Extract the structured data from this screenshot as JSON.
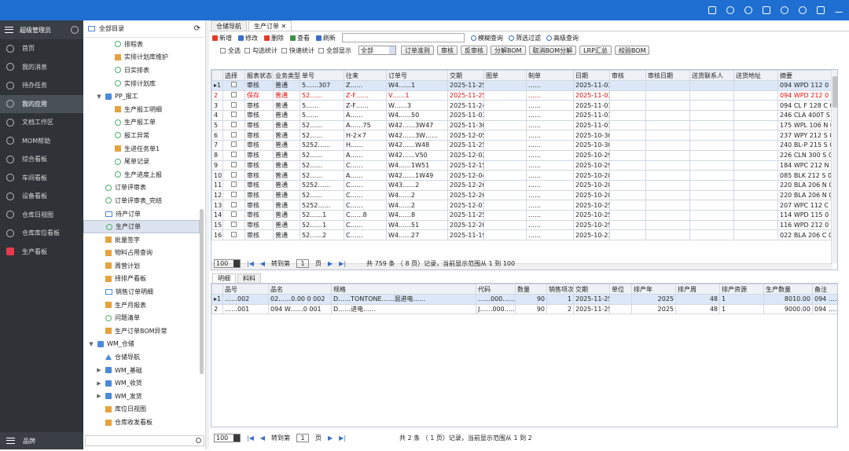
{
  "user": "超级管理员",
  "nav": [
    {
      "label": "首页",
      "active": false
    },
    {
      "label": "我的消息",
      "active": false
    },
    {
      "label": "待办任务",
      "active": false
    },
    {
      "label": "我的应用",
      "active": true
    },
    {
      "label": "文档工作区",
      "active": false
    },
    {
      "label": "MOM帮助",
      "active": false
    },
    {
      "label": "综合看板",
      "active": false
    },
    {
      "label": "车间看板",
      "active": false
    },
    {
      "label": "设备看板",
      "active": false
    },
    {
      "label": "仓库日视图",
      "active": false
    },
    {
      "label": "仓库库位看板",
      "active": false
    },
    {
      "label": "生产看板",
      "active": false
    }
  ],
  "nav_footer": "品牌",
  "tree": {
    "title": "全部目录",
    "search_placeholder": "",
    "nodes": [
      {
        "label": "排程表",
        "icon": "g",
        "indent": 1,
        "arrow": ""
      },
      {
        "label": "实排计划库维护",
        "icon": "sq",
        "indent": 1,
        "arrow": ""
      },
      {
        "label": "日实排表",
        "icon": "g",
        "indent": 1,
        "arrow": ""
      },
      {
        "label": "实排计划库",
        "icon": "g",
        "indent": 1,
        "arrow": ""
      },
      {
        "label": "PP_报工",
        "icon": "b",
        "indent": 0,
        "arrow": "▼"
      },
      {
        "label": "生产报工明细",
        "icon": "sq",
        "indent": 1,
        "arrow": ""
      },
      {
        "label": "生产报工单",
        "icon": "g",
        "indent": 1,
        "arrow": ""
      },
      {
        "label": "报工异常",
        "icon": "g",
        "indent": 1,
        "arrow": ""
      },
      {
        "label": "生进任务单1",
        "icon": "sq",
        "indent": 1,
        "arrow": ""
      },
      {
        "label": "尾单记录",
        "icon": "g",
        "indent": 1,
        "arrow": ""
      },
      {
        "label": "生产进度上报",
        "icon": "g",
        "indent": 1,
        "arrow": ""
      },
      {
        "label": "订单评审表",
        "icon": "g",
        "indent": 0,
        "arrow": ""
      },
      {
        "label": "订单评审表_完结",
        "icon": "g",
        "indent": 0,
        "arrow": ""
      },
      {
        "label": "待产订单",
        "icon": "f",
        "indent": 0,
        "arrow": ""
      },
      {
        "label": "生产订单",
        "icon": "g",
        "indent": 0,
        "arrow": "",
        "selected": true
      },
      {
        "label": "批量签字",
        "icon": "sq",
        "indent": 0,
        "arrow": ""
      },
      {
        "label": "物料占用查询",
        "icon": "sq",
        "indent": 0,
        "arrow": ""
      },
      {
        "label": "周营计划",
        "icon": "sq",
        "indent": 0,
        "arrow": ""
      },
      {
        "label": "择排产看板",
        "icon": "sq",
        "indent": 0,
        "arrow": ""
      },
      {
        "label": "销售订单明细",
        "icon": "f",
        "indent": 0,
        "arrow": ""
      },
      {
        "label": "生产月报表",
        "icon": "sq",
        "indent": 0,
        "arrow": ""
      },
      {
        "label": "问题清单",
        "icon": "g",
        "indent": 0,
        "arrow": ""
      },
      {
        "label": "生产订单BOM异常",
        "icon": "sq",
        "indent": 0,
        "arrow": ""
      },
      {
        "label": "WM_仓储",
        "icon": "b",
        "indent": -1,
        "arrow": "▼"
      },
      {
        "label": "仓储导航",
        "icon": "t",
        "indent": 0,
        "arrow": ""
      },
      {
        "label": "WM_基础",
        "icon": "b",
        "indent": 0,
        "arrow": "▶"
      },
      {
        "label": "WM_收货",
        "icon": "b",
        "indent": 0,
        "arrow": "▶"
      },
      {
        "label": "WM_发货",
        "icon": "b",
        "indent": 0,
        "arrow": "▶"
      },
      {
        "label": "库位日视图",
        "icon": "sq",
        "indent": 0,
        "arrow": ""
      },
      {
        "label": "仓库收发看板",
        "icon": "sq",
        "indent": 0,
        "arrow": ""
      }
    ]
  },
  "tabs": [
    {
      "label": "仓储导航"
    },
    {
      "label": "生产订单 ✕"
    }
  ],
  "toolbar": [
    {
      "label": "新增",
      "color": "#e23b2a"
    },
    {
      "label": "修改",
      "color": "#3b6fc4"
    },
    {
      "label": "删除",
      "color": "#e23b2a"
    },
    {
      "label": "查看",
      "color": "#3b8f4a"
    },
    {
      "label": "刷新",
      "color": "#3b6fc4"
    }
  ],
  "search": {
    "value": ""
  },
  "search_tools": [
    {
      "label": "模糊查询"
    },
    {
      "label": "筛选过滤"
    },
    {
      "label": "高级查询"
    }
  ],
  "checks": [
    {
      "label": "全选"
    },
    {
      "label": "勾选统计"
    },
    {
      "label": "快速统计"
    },
    {
      "label": "全部显示"
    }
  ],
  "filter_select": "全部",
  "buttons": [
    {
      "label": "订单准则"
    },
    {
      "label": "审核"
    },
    {
      "label": "反审核"
    },
    {
      "label": "分解BOM"
    },
    {
      "label": "取消BOM分解"
    },
    {
      "label": "LRP汇总"
    },
    {
      "label": "校验BOM"
    }
  ],
  "grid": {
    "columns": [
      "",
      "选择",
      "报表状态",
      "业务类型",
      "单号",
      "往来",
      "订单号",
      "交期",
      "图单",
      "制单",
      "日期",
      "审核",
      "审核日期",
      "送货联系人",
      "送货地址",
      "摘要"
    ],
    "rows": [
      {
        "n": "1",
        "mark": "▸",
        "status": "审核",
        "type": "普通",
        "no": "5……307",
        "party": "Z……",
        "order": "W4……1",
        "due": "2025-11-25",
        "d2": "",
        "maker": "……",
        "date": "2025-11-03",
        "summary": "094 WPD 112 0 000",
        "sel": true,
        "red": false
      },
      {
        "n": "2",
        "mark": "",
        "status": "保存",
        "type": "普通",
        "no": "52……",
        "party": "Z-F……",
        "order": "V……1",
        "due": "2025-11-25",
        "d2": "",
        "maker": "……",
        "date": "2025-11-03",
        "summary": "094 WPD 212 0 000",
        "sel": false,
        "red": true
      },
      {
        "n": "3",
        "mark": "",
        "status": "审核",
        "type": "普通",
        "no": "5……",
        "party": "Z-F……",
        "order": "W……3",
        "due": "2025-11-24",
        "d2": "",
        "maker": "……",
        "date": "2025-11-01",
        "summary": "094 CL F 128 C 012 C",
        "sel": false,
        "red": false
      },
      {
        "n": "4",
        "mark": "",
        "status": "审核",
        "type": "普通",
        "no": "5……",
        "party": "A……",
        "order": "W4……50",
        "due": "2025-11-03",
        "d2": "",
        "maker": "……",
        "date": "2025-11-01",
        "summary": "246 CLA 400T S 024",
        "sel": false,
        "red": false
      },
      {
        "n": "5",
        "mark": "",
        "status": "审核",
        "type": "普通",
        "no": "52……",
        "party": "A……75",
        "order": "W42……3W47",
        "due": "2025-11-30",
        "d2": "",
        "maker": "……",
        "date": "2025-11-01",
        "summary": "175 WPL 106 N 020 (",
        "sel": false,
        "red": false
      },
      {
        "n": "6",
        "mark": "",
        "status": "审核",
        "type": "普通",
        "no": "52……",
        "party": "H-2×7",
        "order": "W42……3W……",
        "due": "2025-12-05",
        "d2": "",
        "maker": "……",
        "date": "2025-10-30",
        "summary": "237 WPY 212 S 040",
        "sel": false,
        "red": false
      },
      {
        "n": "7",
        "mark": "",
        "status": "审核",
        "type": "普通",
        "no": "5252……",
        "party": "H……",
        "order": "W42……W48",
        "due": "2025-11-25",
        "d2": "",
        "maker": "……",
        "date": "2025-10-30",
        "summary": "240 BL-P 215 S 030 (",
        "sel": false,
        "red": false
      },
      {
        "n": "8",
        "mark": "",
        "status": "审核",
        "type": "普通",
        "no": "52……",
        "party": "A……",
        "order": "W42……V50",
        "due": "2025-12-02",
        "d2": "",
        "maker": "……",
        "date": "2025-10-29",
        "summary": "226 CLN 300 S 024 0",
        "sel": false,
        "red": false
      },
      {
        "n": "9",
        "mark": "",
        "status": "审核",
        "type": "普通",
        "no": "52……",
        "party": "C……",
        "order": "W4……1W51",
        "due": "2025-12-15",
        "d2": "",
        "maker": "……",
        "date": "2025-10-29",
        "summary": "184 WPC 212 N 040",
        "sel": false,
        "red": false
      },
      {
        "n": "10",
        "mark": "",
        "status": "审核",
        "type": "普通",
        "no": "52……",
        "party": "A……",
        "order": "W42……1W49",
        "due": "2025-12-04",
        "d2": "",
        "maker": "……",
        "date": "2025-10-28",
        "summary": "085 BLK 212 S 048 0",
        "sel": false,
        "red": false
      },
      {
        "n": "11",
        "mark": "",
        "status": "审核",
        "type": "普通",
        "no": "5252……",
        "party": "C……",
        "order": "W43……2",
        "due": "2025-12-26",
        "d2": "",
        "maker": "……",
        "date": "2025-10-28",
        "summary": "220 BLA 206 N 010 0",
        "sel": false,
        "red": false
      },
      {
        "n": "12",
        "mark": "",
        "status": "审核",
        "type": "普通",
        "no": "52……",
        "party": "C……",
        "order": "W4……2",
        "due": "2025-12-26",
        "d2": "",
        "maker": "……",
        "date": "2025-10-28",
        "summary": "220 BLA 206 N 010 0",
        "sel": false,
        "red": false
      },
      {
        "n": "13",
        "mark": "",
        "status": "审核",
        "type": "普通",
        "no": "5252……",
        "party": "C……",
        "order": "W4……2",
        "due": "2025-12-07",
        "d2": "",
        "maker": "……",
        "date": "2025-10-25",
        "summary": "207 WPC 112 C 035 (",
        "sel": false,
        "red": false
      },
      {
        "n": "14",
        "mark": "",
        "status": "审核",
        "type": "普通",
        "no": "52……1",
        "party": "C……8",
        "order": "W4……8",
        "due": "2025-11-25",
        "d2": "",
        "maker": "……",
        "date": "2025-10-25",
        "summary": "114 WPD 115 0 000",
        "sel": false,
        "red": false
      },
      {
        "n": "15",
        "mark": "",
        "status": "审核",
        "type": "普通",
        "no": "52……1",
        "party": "C……",
        "order": "W4……51",
        "due": "2025-12-20",
        "d2": "",
        "maker": "……",
        "date": "2025-10-25",
        "summary": "116 WPD 212 0 000",
        "sel": false,
        "red": false
      },
      {
        "n": "16",
        "mark": "",
        "status": "审核",
        "type": "普通",
        "no": "52……2",
        "party": "C……",
        "order": "W4……27",
        "due": "2025-11-19",
        "d2": "",
        "maker": "……",
        "date": "2025-10-23",
        "summary": "022 BLA 206 C 010 0",
        "sel": false,
        "red": false
      }
    ]
  },
  "pager1": {
    "size": "100",
    "page": "1",
    "goto": "转到第",
    "unit": "页",
    "info": "共 759 条 （ 8 页）记录，当前显示范围从 1 到 100"
  },
  "subtabs": [
    {
      "label": "明细"
    },
    {
      "label": "料料"
    }
  ],
  "detail": {
    "columns": [
      "",
      "品号",
      "品名",
      "规格",
      "代码",
      "数量",
      "销售项次",
      "交期",
      "单位",
      "排产年",
      "排产周",
      "排产资源",
      "生产数量",
      "备注"
    ],
    "rows": [
      {
        "n": "1",
        "mark": "▸",
        "pno": "……002",
        "pname": "02……0.00 0 002",
        "spec": "D……TONTONE……混进电……",
        "code": "……000……",
        "qty": "90",
        "item": "1",
        "due": "2025-11-25",
        "unit": "",
        "year": "2025",
        "week": "48",
        "res": "1",
        "prod": "8010.00",
        "memo": "094 ……",
        "sel": true
      },
      {
        "n": "2",
        "mark": "",
        "pno": "……001",
        "pname": "094 W……0 001",
        "spec": "D……进电……",
        "code": "J……000……",
        "qty": "90",
        "item": "2",
        "due": "2025-11-25",
        "unit": "",
        "year": "2025",
        "week": "48",
        "res": "1",
        "prod": "9000.00",
        "memo": "094 ……",
        "sel": false
      }
    ]
  },
  "pager2": {
    "size": "100",
    "page": "1",
    "goto": "转到第",
    "unit": "页",
    "info": "共 2 条 （ 1 页）记录，当前显示范围从 1 到 2"
  }
}
